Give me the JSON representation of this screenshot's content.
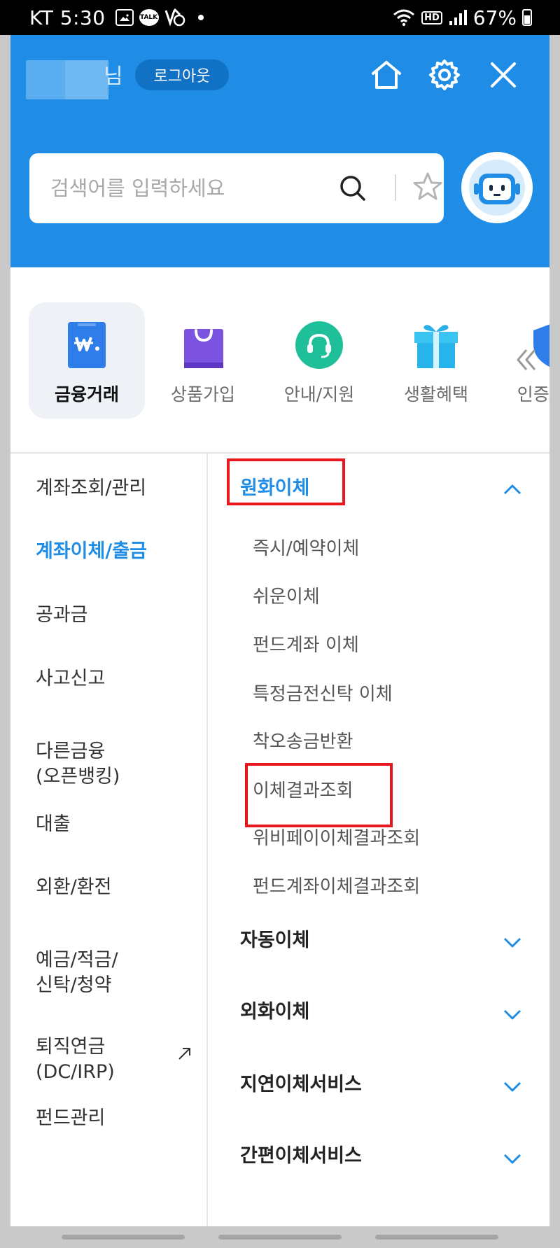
{
  "status_bar": {
    "time": "KT 5:30",
    "battery": "67%"
  },
  "header": {
    "name_suffix": "님",
    "logout_label": "로그아웃",
    "icons": [
      "home-icon",
      "gear-icon",
      "close-icon"
    ],
    "search_placeholder": "검색어를 입력하세요",
    "accent_color": "#1f8ce6"
  },
  "categories": [
    {
      "label": "금융거래",
      "icon": "wallet-won-icon",
      "active": true
    },
    {
      "label": "상품가입",
      "icon": "shopping-bag-icon"
    },
    {
      "label": "안내/지원",
      "icon": "headset-icon"
    },
    {
      "label": "생활혜택",
      "icon": "gift-icon"
    },
    {
      "label": "인증/보안",
      "icon": "shield-lock-icon"
    }
  ],
  "left_nav": [
    {
      "label": "계좌조회/관리"
    },
    {
      "label": "계좌이체/출금",
      "active": true
    },
    {
      "label": "공과금"
    },
    {
      "label": "사고신고"
    },
    {
      "label": "다른금융\n(오픈뱅킹)"
    },
    {
      "label": "대출"
    },
    {
      "label": "외환/환전"
    },
    {
      "label": "예금/적금/\n신탁/청약"
    },
    {
      "label": "퇴직연금\n(DC/IRP)",
      "external": true
    },
    {
      "label": "펀드관리"
    }
  ],
  "sections": [
    {
      "title": "원화이체",
      "expanded": true,
      "items": [
        "즉시/예약이체",
        "쉬운이체",
        "펀드계좌 이체",
        "특정금전신탁 이체",
        "착오송금반환",
        "이체결과조회",
        "위비페이이체결과조회",
        "펀드계좌이체결과조회"
      ]
    },
    {
      "title": "자동이체",
      "expanded": false
    },
    {
      "title": "외화이체",
      "expanded": false
    },
    {
      "title": "지연이체서비스",
      "expanded": false
    },
    {
      "title": "간편이체서비스",
      "expanded": false
    }
  ],
  "highlight_color": "#e8161f"
}
